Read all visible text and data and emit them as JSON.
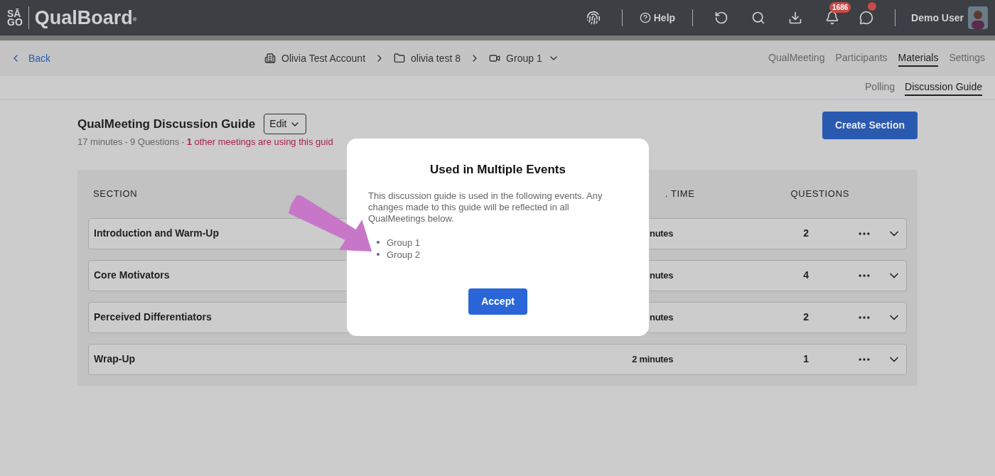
{
  "header": {
    "logo_mark_top": "SĀ",
    "logo_mark_bottom": "GO",
    "logo": "QualBoard",
    "logo_reg": "®",
    "help": "Help",
    "notification_count": "1686",
    "chat_unread": true,
    "user": "Demo User"
  },
  "nav": {
    "back": "Back",
    "breadcrumbs": [
      {
        "kind": "account",
        "label": "Olivia Test Account"
      },
      {
        "kind": "folder",
        "label": "olivia test 8"
      },
      {
        "kind": "meeting",
        "label": "Group 1"
      }
    ],
    "tabs": [
      {
        "label": "QualMeeting",
        "selected": false
      },
      {
        "label": "Participants",
        "selected": false
      },
      {
        "label": "Materials",
        "selected": true
      },
      {
        "label": "Settings",
        "selected": false
      }
    ]
  },
  "subtabs": [
    {
      "label": "Polling",
      "selected": false
    },
    {
      "label": "Discussion Guide",
      "selected": true
    }
  ],
  "guide": {
    "title": "QualMeeting Discussion Guide",
    "edit": "Edit",
    "minutes": "17 minutes",
    "separator_1": "-",
    "questions": "9 Questions",
    "separator_2": "-",
    "warning": "**1** other meetings are using this guid",
    "create": "Create Section"
  },
  "table": {
    "columns": [
      "SECTION",
      ". TIME",
      "QUESTIONS"
    ],
    "rows": [
      {
        "section": "Introduction and Warm-Up",
        "time": "nutes",
        "questions": "2"
      },
      {
        "section": "Core Motivators",
        "time": "nutes",
        "questions": "4"
      },
      {
        "section": "Perceived Differentiators",
        "time": "nutes",
        "questions": "2"
      },
      {
        "section": "Wrap-Up",
        "time": "2 minutes",
        "questions": "1"
      }
    ]
  },
  "modal": {
    "title": "Used in Multiple Events",
    "body": "This discussion guide is used in the following events. Any changes made to this guide will be reflected in all QualMeetings below.",
    "events": [
      "Group 1",
      "Group 2"
    ],
    "accept": "Accept"
  }
}
